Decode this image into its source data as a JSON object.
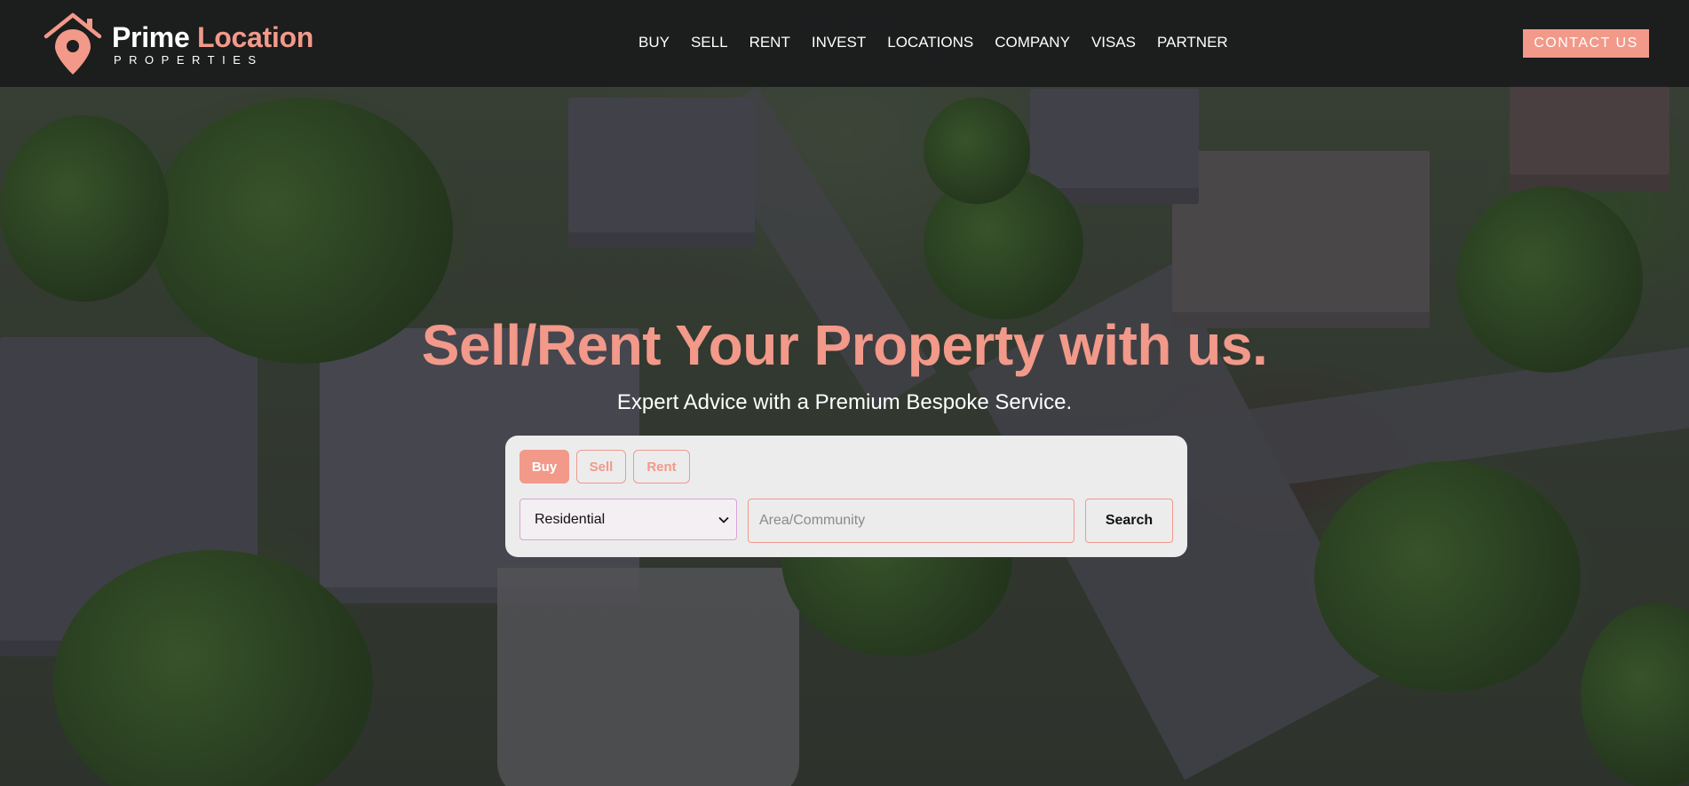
{
  "brand": {
    "name_primary": "Prime",
    "name_accent": "Location",
    "tagline": "PROPERTIES",
    "accent_color": "#f2998a",
    "logo_icon": "location-pin-house-icon"
  },
  "nav": {
    "items": [
      "BUY",
      "SELL",
      "RENT",
      "INVEST",
      "LOCATIONS",
      "COMPANY",
      "VISAS",
      "PARTNER"
    ]
  },
  "header": {
    "contact_label": "CONTACT US"
  },
  "hero": {
    "title": "Sell/Rent Your Property with us.",
    "subtitle": "Expert Advice with a Premium Bespoke Service."
  },
  "search": {
    "tabs": [
      {
        "label": "Buy",
        "active": true
      },
      {
        "label": "Sell",
        "active": false
      },
      {
        "label": "Rent",
        "active": false
      }
    ],
    "property_type": "Residential",
    "area_placeholder": "Area/Community",
    "search_label": "Search"
  }
}
